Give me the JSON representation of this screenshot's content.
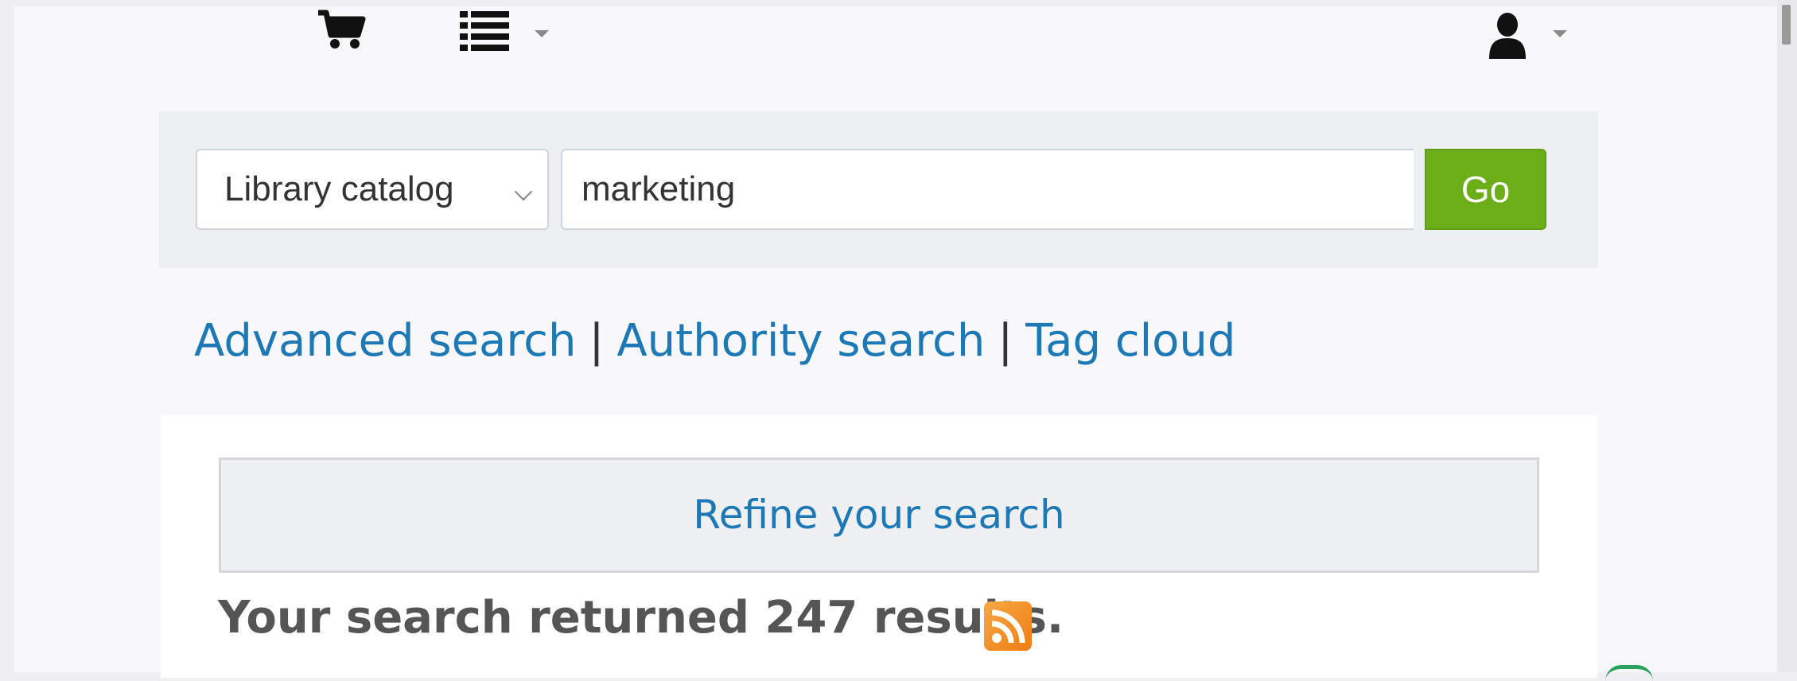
{
  "topbar": {
    "cart_icon": "cart-icon",
    "lists_icon": "list-icon",
    "user_icon": "user-icon"
  },
  "search": {
    "catalog_selected": "Library catalog",
    "query": "marketing",
    "go_label": "Go"
  },
  "links": {
    "advanced": "Advanced search",
    "authority": "Authority search",
    "tag_cloud": "Tag cloud",
    "separator": "|"
  },
  "results": {
    "refine_label": "Refine your search",
    "count_text": "Your search returned 247 results."
  },
  "colors": {
    "link": "#1d78b6",
    "go_button": "#6cae18",
    "rss": "#ef7d12"
  }
}
